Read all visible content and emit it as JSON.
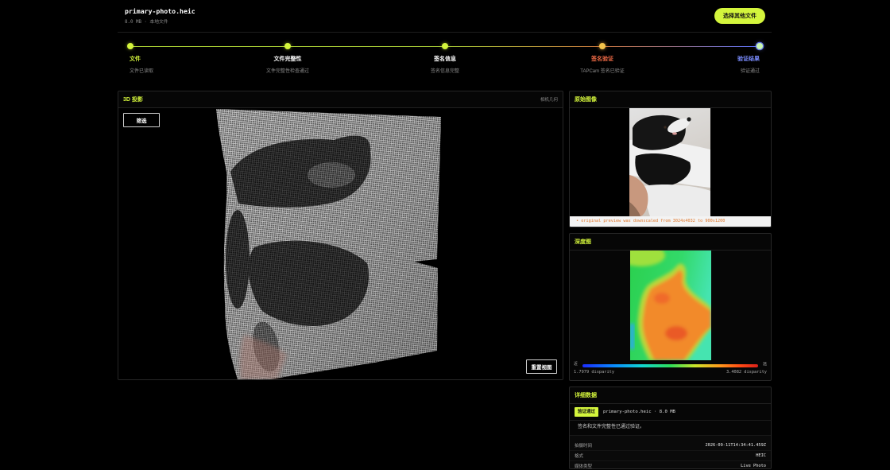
{
  "theme": {
    "accent": "#d4f53c",
    "warning": "#ef6a45",
    "info": "#7a8cff"
  },
  "header": {
    "title": "primary-photo.heic",
    "meta": "8.0 MB · 本地文件",
    "choose_button": "选择其他文件"
  },
  "steps": [
    {
      "label": "文件",
      "status": "文件已读取",
      "color": "#d4f53c",
      "dot": "#d4f53c"
    },
    {
      "label": "文件完整性",
      "status": "文件完整性检查通过",
      "color": "#ffffff",
      "dot": "#d4f53c"
    },
    {
      "label": "签名信息",
      "status": "签名信息完整",
      "color": "#ffffff",
      "dot": "#d4f53c"
    },
    {
      "label": "签名验证",
      "status": "TAPCam 签名已验证",
      "color": "#ef6a45",
      "dot": "#f3c34b"
    },
    {
      "label": "验证结果",
      "status": "验证通过",
      "color": "#7a8cff",
      "dot": "#c9f7b0"
    }
  ],
  "projection": {
    "title": "3D 投影",
    "mode": "相机几何",
    "filter_button": "筛选",
    "reset_button": "重置视图"
  },
  "original": {
    "title": "原始图像",
    "note": "• original preview was downscaled from 3024x4032 to 900x1200"
  },
  "depth": {
    "title": "深度图",
    "near": "近",
    "far": "远",
    "min": "1.7979 disparity",
    "max": "3.4082 disparity"
  },
  "details": {
    "title": "详细数据",
    "badge": "验证通过",
    "file": "primary-photo.heic · 8.0 MB",
    "message": "签名和文件完整性已通过验证。",
    "rows": [
      {
        "key": "拍摄时间",
        "value": "2026-09-11T14:34:41.459Z"
      },
      {
        "key": "格式",
        "value": "HEIC"
      },
      {
        "key": "媒体类型",
        "value": "Live Photo"
      }
    ]
  }
}
